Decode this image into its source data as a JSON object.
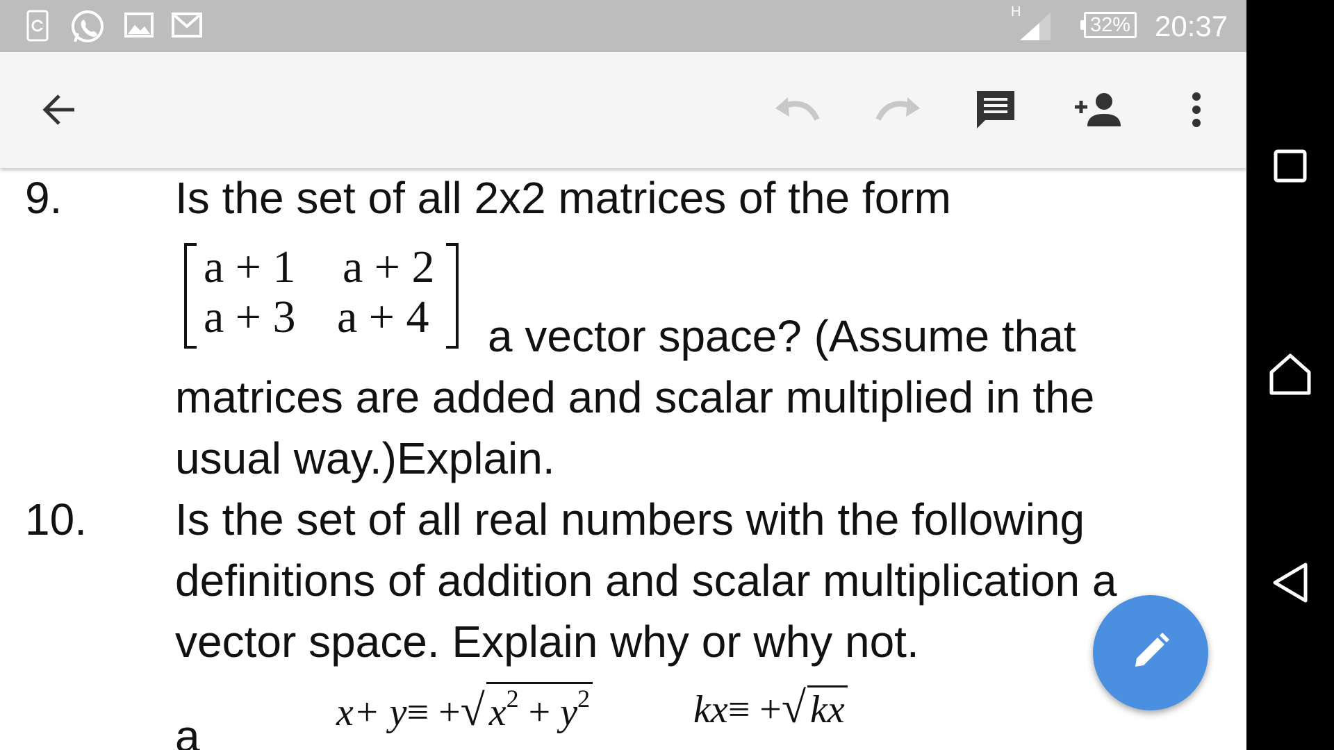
{
  "status_bar": {
    "network_type": "H",
    "battery": "32%",
    "time": "20:37",
    "left_icons": [
      "cast-icon",
      "whatsapp-icon",
      "gallery-icon",
      "gmail-icon"
    ]
  },
  "toolbar": {
    "icons": [
      "back-arrow-icon",
      "undo-icon",
      "redo-icon",
      "comment-icon",
      "add-person-icon",
      "more-vert-icon"
    ]
  },
  "document": {
    "q9": {
      "number": "9.",
      "line1": "Is the set of all 2x2 matrices of the form",
      "matrix": {
        "r1c1": "a + 1",
        "r1c2": "a + 2",
        "r2c1": "a + 3",
        "r2c2": "a + 4"
      },
      "line2": "a vector space? (Assume that",
      "line3": "matrices are added and scalar multiplied in the",
      "line4": "usual way.)Explain."
    },
    "q10": {
      "number": "10.",
      "line1": "Is the set of all real numbers with the following",
      "line2": "definitions of addition and scalar multiplication a",
      "line3": "vector space. Explain why or why not.",
      "sub_label": "a",
      "formula1": {
        "lhs": "x+ y",
        "op": "≡ +",
        "rad_a": "x",
        "exp_a": "2",
        "plus": " + ",
        "rad_b": "y",
        "exp_b": "2"
      },
      "formula2": {
        "lhs": "kx",
        "op": "≡ +",
        "rad": "kx"
      }
    }
  },
  "nav_bar": {
    "icons": [
      "recents-icon",
      "home-icon",
      "back-icon"
    ]
  },
  "fab": {
    "icon": "edit-pencil-icon",
    "color": "#4a8fe0"
  }
}
